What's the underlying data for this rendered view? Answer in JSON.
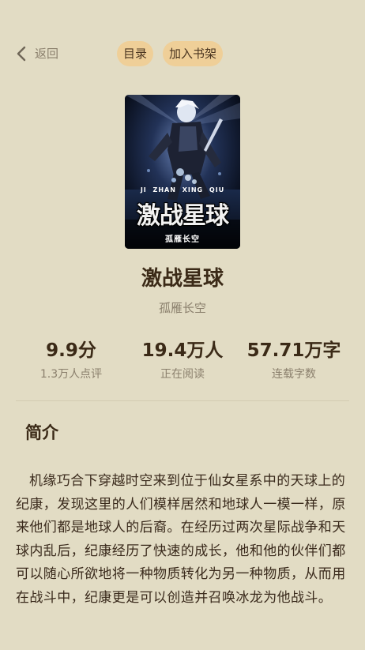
{
  "header": {
    "back_label": "返回",
    "back_icon": "chevron-left-icon",
    "catalog_label": "目录",
    "add_bookshelf_label": "加入书架"
  },
  "cover": {
    "pinyin": "JI ZHAN XING QIU",
    "title_art": "激战星球",
    "author_art": "孤雁长空"
  },
  "book": {
    "title": "激战星球",
    "author": "孤雁长空"
  },
  "stats": [
    {
      "value": "9.9分",
      "label": "1.3万人点评"
    },
    {
      "value": "19.4万人",
      "label": "正在阅读"
    },
    {
      "value": "57.71万字",
      "label": "连载字数"
    }
  ],
  "intro": {
    "heading": "简介",
    "text": "机缘巧合下穿越时空来到位于仙女星系中的天球上的纪康，发现这里的人们模样居然和地球人一模一样，原来他们都是地球人的后裔。在经历过两次星际战争和天球内乱后，纪康经历了快速的成长，他和他的伙伴们都可以随心所欲地将一种物质转化为另一种物质，从而用在战斗中，纪康更是可以创造并召唤冰龙为他战斗。"
  },
  "colors": {
    "background": "#e2dcc4",
    "pill": "#efcf98",
    "title_text": "#3b2a17",
    "muted_text": "#8a7f6c"
  }
}
